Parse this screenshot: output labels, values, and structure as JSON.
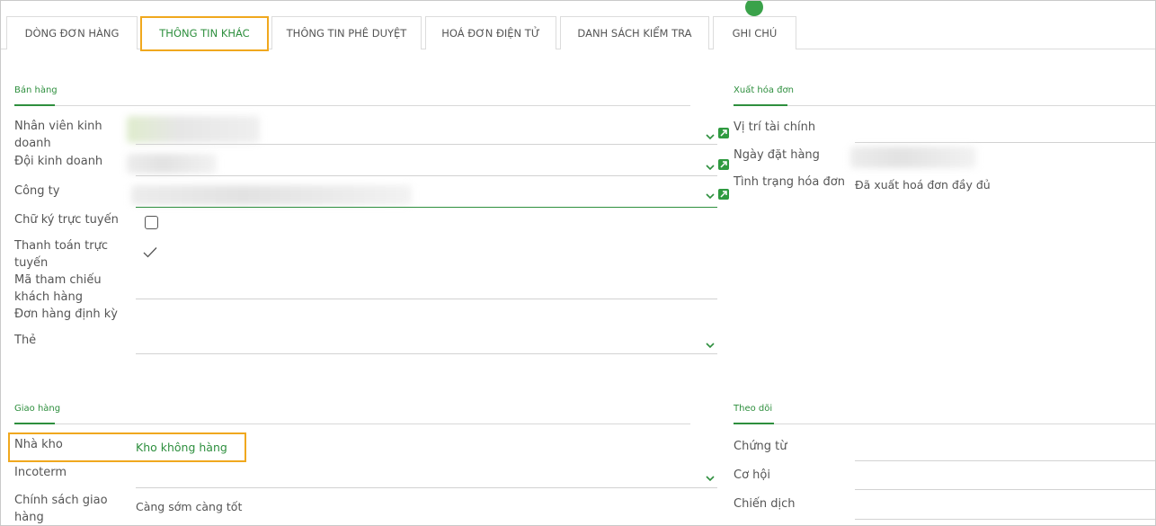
{
  "tabs": [
    {
      "label": "DÒNG ĐƠN HÀNG"
    },
    {
      "label": "THÔNG TIN KHÁC"
    },
    {
      "label": "THÔNG TIN PHÊ DUYỆT"
    },
    {
      "label": "HOÁ ĐƠN ĐIỆN TỬ"
    },
    {
      "label": "DANH SÁCH KIỂM TRA"
    },
    {
      "label": "GHI CHÚ"
    }
  ],
  "active_tab": "THÔNG TIN KHÁC",
  "sales": {
    "title": "Bán hàng",
    "salesperson_label": "Nhân viên kinh doanh",
    "sales_team_label": "Đội kinh doanh",
    "company_label": "Công ty",
    "online_signature_label": "Chữ ký trực tuyến",
    "online_payment_label": "Thanh toán trực tuyến",
    "customer_reference_label": "Mã tham chiếu khách hàng",
    "recurring_order_label": "Đơn hàng định kỳ",
    "tags_label": "Thẻ",
    "online_signature_checked": false,
    "online_payment_checked": true
  },
  "invoicing": {
    "title": "Xuất hóa đơn",
    "fiscal_position_label": "Vị trí tài chính",
    "order_date_label": "Ngày đặt hàng",
    "invoice_status_label": "Tình trạng hóa đơn",
    "invoice_status_value": "Đã xuất hoá đơn đầy đủ"
  },
  "delivery": {
    "title": "Giao hàng",
    "warehouse_label": "Nhà kho",
    "warehouse_value": "Kho không hàng",
    "incoterm_label": "Incoterm",
    "shipping_policy_label": "Chính sách giao hàng",
    "shipping_policy_value": "Càng sớm càng tốt"
  },
  "tracking": {
    "title": "Theo dõi",
    "source_document_label": "Chứng từ",
    "opportunity_label": "Cơ hội",
    "campaign_label": "Chiến dịch"
  },
  "colors": {
    "accent": "#2e8f3e",
    "highlight": "#f0a81e"
  }
}
